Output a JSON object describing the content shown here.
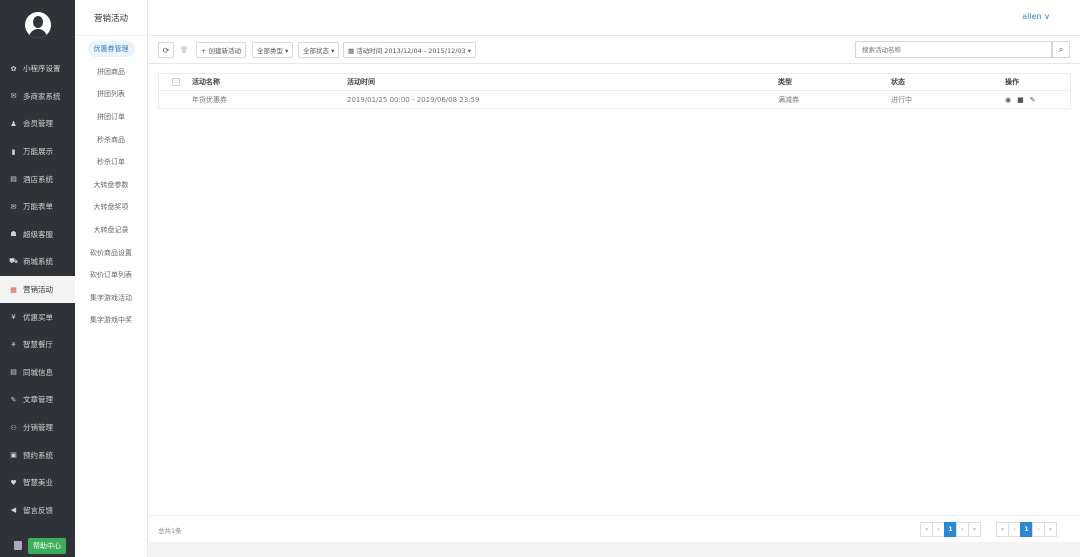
{
  "sidebar": {
    "items": [
      {
        "label": "小程序设置",
        "icon": "gear-icon",
        "glyph": "✿"
      },
      {
        "label": "多商家系统",
        "icon": "envelope-icon",
        "glyph": "✉"
      },
      {
        "label": "会员管理",
        "icon": "user-icon",
        "glyph": "♟"
      },
      {
        "label": "万能展示",
        "icon": "bookmark-icon",
        "glyph": "▮"
      },
      {
        "label": "酒店系统",
        "icon": "document-icon",
        "glyph": "▤"
      },
      {
        "label": "万能表单",
        "icon": "envelope-icon",
        "glyph": "✉"
      },
      {
        "label": "超级客服",
        "icon": "group-icon",
        "glyph": "☗"
      },
      {
        "label": "商城系统",
        "icon": "cart-icon",
        "glyph": "⛟"
      },
      {
        "label": "营销活动",
        "icon": "grid-color-icon",
        "glyph": "▦"
      },
      {
        "label": "优惠买单",
        "icon": "yen-icon",
        "glyph": "¥"
      },
      {
        "label": "智慧餐厅",
        "icon": "cutlery-icon",
        "glyph": "⚘"
      },
      {
        "label": "同城信息",
        "icon": "document-icon",
        "glyph": "▤"
      },
      {
        "label": "文章管理",
        "icon": "pencil-icon",
        "glyph": "✎"
      },
      {
        "label": "分销管理",
        "icon": "sitemap-icon",
        "glyph": "⚇"
      },
      {
        "label": "预约系统",
        "icon": "calendar-icon",
        "glyph": "▣"
      },
      {
        "label": "智慧美业",
        "icon": "heart-icon",
        "glyph": "♥"
      },
      {
        "label": "留言反馈",
        "icon": "speaker-icon",
        "glyph": "◀"
      }
    ],
    "help_label": "帮助中心"
  },
  "submenu": {
    "title": "营销活动",
    "items": [
      "优惠券管理",
      "拼团商品",
      "拼团列表",
      "拼团订单",
      "秒杀商品",
      "秒杀订单",
      "大转盘参数",
      "大转盘奖项",
      "大转盘记录",
      "砍价商品设置",
      "砍价订单列表",
      "集字游戏活动",
      "集字游戏中奖"
    ]
  },
  "header": {
    "user": "allen ∨"
  },
  "toolbar": {
    "refresh": "⟳",
    "delete": "🗑",
    "create": "+ 创建新活动",
    "type_filter": "全部类型 ▾",
    "status_filter": "全部状态 ▾",
    "date_filter": "▦ 活动时间 2013/12/04 - 2015/12/03 ▾",
    "search_placeholder": "搜索活动名称",
    "search_icon": "⌕"
  },
  "table": {
    "columns": [
      "活动名称",
      "活动时间",
      "类型",
      "状态",
      "操作"
    ],
    "rows": [
      {
        "name": "年货优惠券",
        "time": "2019/01/25 00:00 - 2019/06/08 23:59",
        "type": "满减券",
        "status": "进行中"
      }
    ],
    "ops_icons": {
      "stats": "◉",
      "stop": "■",
      "edit": "✎"
    }
  },
  "footer": {
    "total": "总共1条",
    "pager": [
      "«",
      "‹",
      "1",
      "›",
      "»"
    ]
  },
  "colors": {
    "sidebar_bg": "#2f3337",
    "accent": "#2a87d8",
    "help_green": "#3fae5a"
  }
}
